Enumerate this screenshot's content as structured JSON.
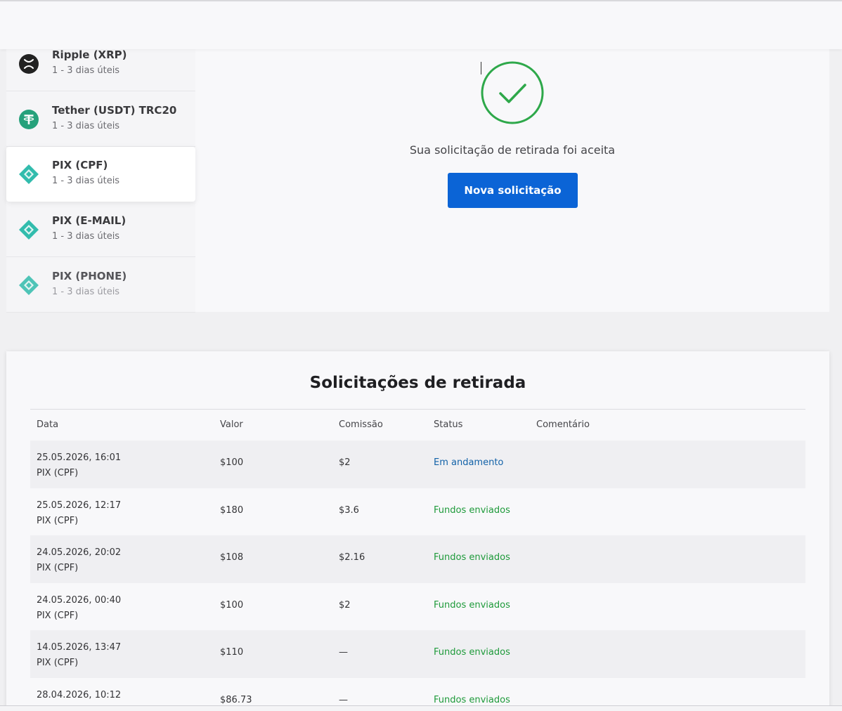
{
  "methods": [
    {
      "name": "Ripple (XRP)",
      "time": "1 - 3 dias úteis",
      "icon": "ripple-icon",
      "color": "#222222"
    },
    {
      "name": "Tether (USDT) TRC20",
      "time": "1 - 3 dias úteis",
      "icon": "tether-icon",
      "color": "#26a17b"
    },
    {
      "name": "PIX (CPF)",
      "time": "1 - 3 dias úteis",
      "icon": "pix-icon",
      "color": "#32bcad",
      "active": true
    },
    {
      "name": "PIX (E-MAIL)",
      "time": "1 - 3 dias úteis",
      "icon": "pix-icon",
      "color": "#32bcad"
    },
    {
      "name": "PIX (PHONE)",
      "time": "1 - 3 dias úteis",
      "icon": "pix-icon",
      "color": "#32bcad"
    }
  ],
  "success": {
    "icon": "check-circle-icon",
    "color": "#2ea84a",
    "message": "Sua solicitação de retirada foi aceita",
    "button_label": "Nova solicitação",
    "button_color": "#0b64d6"
  },
  "requests": {
    "title": "Solicitações de retirada",
    "columns": {
      "date": "Data",
      "value": "Valor",
      "commission": "Comissão",
      "status": "Status",
      "comment": "Comentário"
    },
    "rows": [
      {
        "date": "25.05.2026, 16:01",
        "method": "PIX (CPF)",
        "value": "$100",
        "commission": "$2",
        "status": "Em andamento",
        "status_type": "progress"
      },
      {
        "date": "25.05.2026, 12:17",
        "method": "PIX (CPF)",
        "value": "$180",
        "commission": "$3.6",
        "status": "Fundos enviados",
        "status_type": "sent"
      },
      {
        "date": "24.05.2026, 20:02",
        "method": "PIX (CPF)",
        "value": "$108",
        "commission": "$2.16",
        "status": "Fundos enviados",
        "status_type": "sent"
      },
      {
        "date": "24.05.2026, 00:40",
        "method": "PIX (CPF)",
        "value": "$100",
        "commission": "$2",
        "status": "Fundos enviados",
        "status_type": "sent"
      },
      {
        "date": "14.05.2026, 13:47",
        "method": "PIX (CPF)",
        "value": "$110",
        "commission": "—",
        "status": "Fundos enviados",
        "status_type": "sent"
      },
      {
        "date": "28.04.2026, 10:12",
        "method": "",
        "value": "$86.73",
        "commission": "—",
        "status": "Fundos enviados",
        "status_type": "sent"
      }
    ],
    "status_colors": {
      "progress": "#1262a8",
      "sent": "#1e9a3a"
    }
  }
}
